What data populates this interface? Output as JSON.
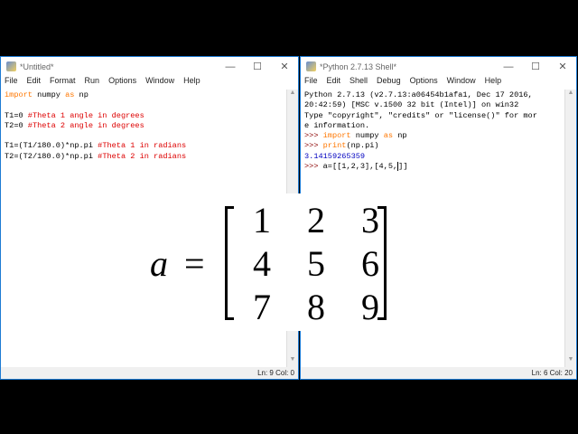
{
  "editor": {
    "title": "*Untitled*",
    "menu": [
      "File",
      "Edit",
      "Format",
      "Run",
      "Options",
      "Window",
      "Help"
    ],
    "lines": [
      {
        "kw": "import",
        "rest": " numpy ",
        "kw2": "as",
        "rest2": " np"
      },
      {
        "code": "",
        "comment": ""
      },
      {
        "code": "T1=0 ",
        "comment": "#Theta 1 angle in degrees"
      },
      {
        "code": "T2=0 ",
        "comment": "#Theta 2 angle in degrees"
      },
      {
        "code": "",
        "comment": ""
      },
      {
        "code": "T1=(T1/180.0)*np.pi ",
        "comment": "#Theta 1 in radians"
      },
      {
        "code": "T2=(T2/180.0)*np.pi ",
        "comment": "#Theta 2 in radians"
      }
    ],
    "status": "Ln: 9   Col: 0"
  },
  "shell": {
    "title": "*Python 2.7.13 Shell*",
    "menu": [
      "File",
      "Edit",
      "Shell",
      "Debug",
      "Options",
      "Window",
      "Help"
    ],
    "banner": [
      "Python 2.7.13 (v2.7.13:a06454b1afa1, Dec 17 2016,",
      "20:42:59) [MSC v.1500 32 bit (Intel)] on win32",
      "Type \"copyright\", \"credits\" or \"license()\" for mor",
      "e information."
    ],
    "prompt": ">>> ",
    "cmd1_kw": "import",
    "cmd1_rest": " numpy ",
    "cmd1_kw2": "as",
    "cmd1_rest2": " np",
    "cmd2_kw": "print",
    "cmd2_rest": "(np.pi)",
    "output": "3.14159265359",
    "cmd3": "a=[[1,2,3],[4,5,",
    "cmd3_tail": "]]",
    "status": "Ln: 6   Col: 20"
  },
  "overlay": {
    "lhs": "a",
    "eq": "=",
    "matrix": [
      [
        "1",
        "2",
        "3"
      ],
      [
        "4",
        "5",
        "6"
      ],
      [
        "7",
        "8",
        "9"
      ]
    ]
  }
}
